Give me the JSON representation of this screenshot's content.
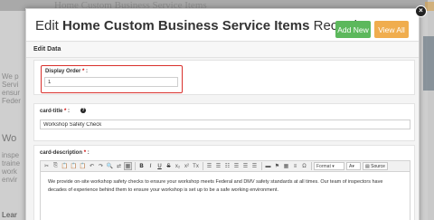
{
  "background": {
    "heading": "Home Custom Business Service Items",
    "left_lines": [
      "We p",
      "Servi",
      "ensur",
      "Feder",
      "inspe",
      "traine",
      "work",
      "envir"
    ],
    "section_heading": "Wo",
    "link": "Lear"
  },
  "modal": {
    "title_prefix": "Edit ",
    "title_bold": "Home Custom Business Service Items",
    "title_suffix": " Record",
    "add_new_label": "Add New",
    "view_all_label": "View All",
    "close_symbol": "×",
    "section_label": "Edit Data"
  },
  "fields": {
    "display_order": {
      "label": "Display Order",
      "required_mark": "*",
      "colon": ":",
      "value": "1"
    },
    "card_title": {
      "label": "card-title",
      "required_mark": "*",
      "colon": ":",
      "info_symbol": "?",
      "value": "Workshop Safety Check"
    },
    "card_description": {
      "label": "card-description",
      "required_mark": "*",
      "colon": ":",
      "value": "We provide on-site workshop safety checks to ensure your workshop meets Federal and DMV safety standards at all times. Our team of inspectors have decades of experience behind them to ensure your workshop is set up to be a safe working environment."
    }
  },
  "toolbar": {
    "group1": [
      "✂",
      "⎘",
      "📋",
      "📋",
      "📋",
      "↶",
      "↷",
      "🔍",
      "⇄",
      "▦"
    ],
    "group2": [
      "B",
      "I",
      "U",
      "S",
      "x₂",
      "x²",
      "Tx"
    ],
    "group3": [
      "☰",
      "☰",
      "☷",
      "☰",
      "☰",
      "☰"
    ],
    "group4": [
      "▬",
      "⚑",
      "▦",
      "≡",
      "Ω"
    ],
    "format_label": "Format",
    "color_label": "A",
    "source_label": "Source"
  },
  "colors": {
    "add_new": "#5cb85c",
    "view_all": "#f0ad4e",
    "highlight": "#d9302c"
  }
}
